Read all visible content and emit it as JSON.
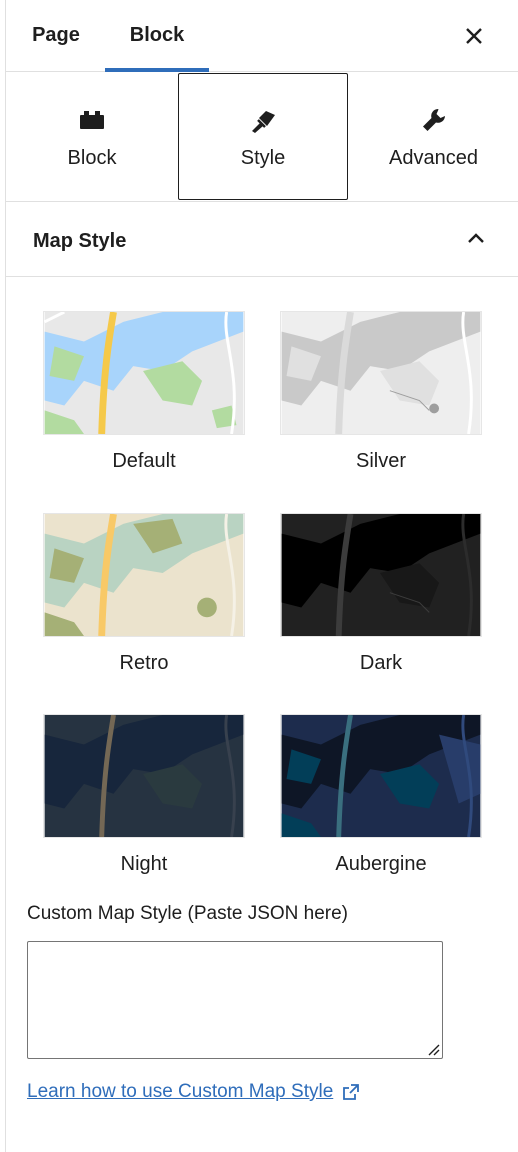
{
  "header": {
    "tabs": [
      {
        "label": "Page",
        "active": false
      },
      {
        "label": "Block",
        "active": true
      }
    ],
    "close_icon": "close-icon"
  },
  "subtabs": [
    {
      "label": "Block",
      "icon": "block-icon",
      "active": false
    },
    {
      "label": "Style",
      "icon": "brush-icon",
      "active": true
    },
    {
      "label": "Advanced",
      "icon": "wrench-icon",
      "active": false
    }
  ],
  "section": {
    "title": "Map Style",
    "expanded": true
  },
  "styles": [
    {
      "name": "Default"
    },
    {
      "name": "Silver"
    },
    {
      "name": "Retro"
    },
    {
      "name": "Dark"
    },
    {
      "name": "Night"
    },
    {
      "name": "Aubergine"
    }
  ],
  "custom": {
    "label": "Custom Map Style (Paste JSON here)",
    "value": "",
    "link_text": "Learn how to use Custom Map Style"
  },
  "colors": {
    "accent": "#2f6dba",
    "text": "#1e1e1e",
    "border": "#e0e0e0"
  }
}
